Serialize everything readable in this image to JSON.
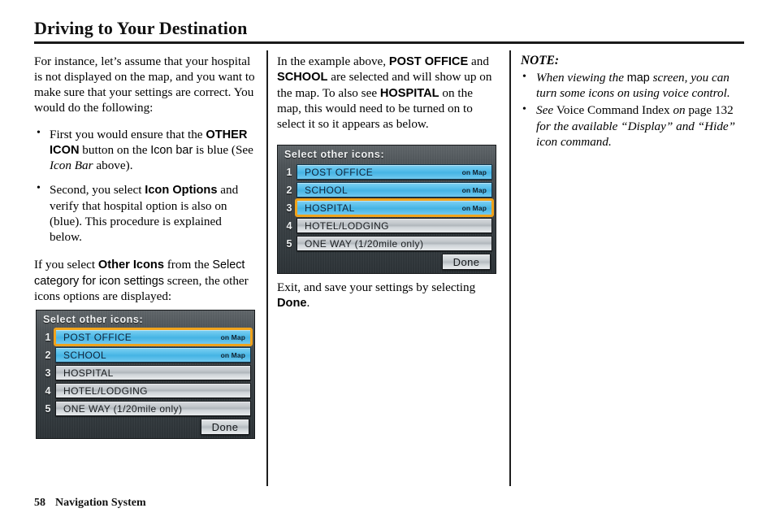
{
  "document": {
    "title": "Driving to Your Destination",
    "footer": {
      "page_number": "58",
      "section": "Navigation System"
    }
  },
  "column_left": {
    "para1": "For instance, let’s assume that your hospital is not displayed on the map, and you want to make sure that your settings are correct. You would do the following:",
    "bullet1": {
      "part1": "First you would ensure that the ",
      "bold": "OTHER ICON",
      "part2": " button on the ",
      "sans": "Icon bar",
      "part3": " is blue (See ",
      "italic": "Icon Bar",
      "part4": " above)."
    },
    "bullet2": {
      "part1": "Second, you select ",
      "bold": "Icon Options",
      "part2": " and verify that hospital option is also on (blue). This procedure is explained below."
    },
    "para2": {
      "part1": "If you select ",
      "bold": "Other Icons",
      "part2": " from the ",
      "sans": "Select category for icon settings",
      "part3": " screen, the other icons options are displayed:"
    }
  },
  "column_middle": {
    "para1": {
      "part1": "In the example above, ",
      "bold1": "POST OFFICE",
      "part2": " and ",
      "bold2": "SCHOOL",
      "part3": " are selected and will show up on the map. To also see ",
      "bold3": "HOSPITAL",
      "part4": " on the map, this would need to be turned on to select it so it appears as below."
    },
    "para2": {
      "part1": "Exit, and save your settings by selecting ",
      "bold": "Done",
      "part2": "."
    }
  },
  "column_right": {
    "note_heading": "NOTE:",
    "note_bullet1": {
      "part1": "When viewing the ",
      "sans": "map",
      "part2": " screen, you can turn some icons on using voice control."
    },
    "note_bullet2": {
      "part1": "See ",
      "upright1": "Voice Command Index",
      "part2": " on ",
      "upright2": "page 132",
      "part3": " for the available “Display” and “Hide” icon command."
    }
  },
  "screenshot_1": {
    "screen_title": "Select other icons:",
    "rows": [
      {
        "num": "1",
        "label": "POST OFFICE",
        "on_map": "on Map",
        "state": "on",
        "selected": true
      },
      {
        "num": "2",
        "label": "SCHOOL",
        "on_map": "on Map",
        "state": "on",
        "selected": false
      },
      {
        "num": "3",
        "label": "HOSPITAL",
        "on_map": "",
        "state": "off",
        "selected": false
      },
      {
        "num": "4",
        "label": "HOTEL/LODGING",
        "on_map": "",
        "state": "off",
        "selected": false
      },
      {
        "num": "5",
        "label": "ONE WAY (1/20mile only)",
        "on_map": "",
        "state": "off",
        "selected": false
      }
    ],
    "done_label": "Done"
  },
  "screenshot_2": {
    "screen_title": "Select other icons:",
    "rows": [
      {
        "num": "1",
        "label": "POST OFFICE",
        "on_map": "on Map",
        "state": "on",
        "selected": false
      },
      {
        "num": "2",
        "label": "SCHOOL",
        "on_map": "on Map",
        "state": "on",
        "selected": false
      },
      {
        "num": "3",
        "label": "HOSPITAL",
        "on_map": "on Map",
        "state": "on",
        "selected": true
      },
      {
        "num": "4",
        "label": "HOTEL/LODGING",
        "on_map": "",
        "state": "off",
        "selected": false
      },
      {
        "num": "5",
        "label": "ONE WAY (1/20mile only)",
        "on_map": "",
        "state": "off",
        "selected": false
      }
    ],
    "done_label": "Done"
  },
  "colors": {
    "selected_row_blue": "#4db4e4",
    "highlight_orange": "#f0a31c",
    "screen_background": "#3d4347",
    "inactive_row_gray": "#c3c8cc"
  }
}
